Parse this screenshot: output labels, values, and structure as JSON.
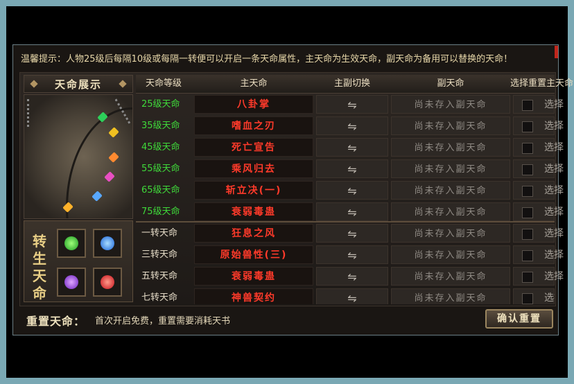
{
  "hint": "温馨提示：人物25级后每隔10级或每隔一转便可以开启一条天命属性，主天命为生效天命，副天命为备用可以替换的天命！",
  "display": {
    "title": "天命展示",
    "reborn_title": "转\n生\n天\n命"
  },
  "table": {
    "headers": {
      "level": "天命等级",
      "main": "主天命",
      "switch": "主副切换",
      "sub": "副天命",
      "pick": "选择重置主天命"
    },
    "rows": [
      {
        "level": "25级天命",
        "main": "八卦掌",
        "switch": "⇋",
        "sub": "尚未存入副天命",
        "pick": "选择"
      },
      {
        "level": "35级天命",
        "main": "嗜血之刃",
        "switch": "⇋",
        "sub": "尚未存入副天命",
        "pick": "选择"
      },
      {
        "level": "45级天命",
        "main": "死亡宣告",
        "switch": "⇋",
        "sub": "尚未存入副天命",
        "pick": "选择"
      },
      {
        "level": "55级天命",
        "main": "乘风归去",
        "switch": "⇋",
        "sub": "尚未存入副天命",
        "pick": "选择"
      },
      {
        "level": "65级天命",
        "main": "斩立决(一)",
        "switch": "⇋",
        "sub": "尚未存入副天命",
        "pick": "选择"
      },
      {
        "level": "75级天命",
        "main": "衰弱毒蛊",
        "switch": "⇋",
        "sub": "尚未存入副天命",
        "pick": "选择"
      },
      {
        "level": "一转天命",
        "main": "狂息之风",
        "switch": "⇋",
        "sub": "尚未存入副天命",
        "pick": "选择"
      },
      {
        "level": "三转天命",
        "main": "原始兽性(三)",
        "switch": "⇋",
        "sub": "尚未存入副天命",
        "pick": "选择"
      },
      {
        "level": "五转天命",
        "main": "衰弱毒蛊",
        "switch": "⇋",
        "sub": "尚未存入副天命",
        "pick": "选择"
      },
      {
        "level": "七转天命",
        "main": "神兽契约",
        "switch": "⇋",
        "sub": "尚未存入副天命",
        "pick": "选择"
      }
    ]
  },
  "footer": {
    "reset_title": "重置天命：",
    "reset_desc": "首次开启免费，重置需要消耗天书",
    "confirm_label": "确认重置"
  },
  "colors": {
    "level_green": "#3fd93a",
    "main_red": "#ff3a2a",
    "frame_blue": "#7aa8b4"
  }
}
